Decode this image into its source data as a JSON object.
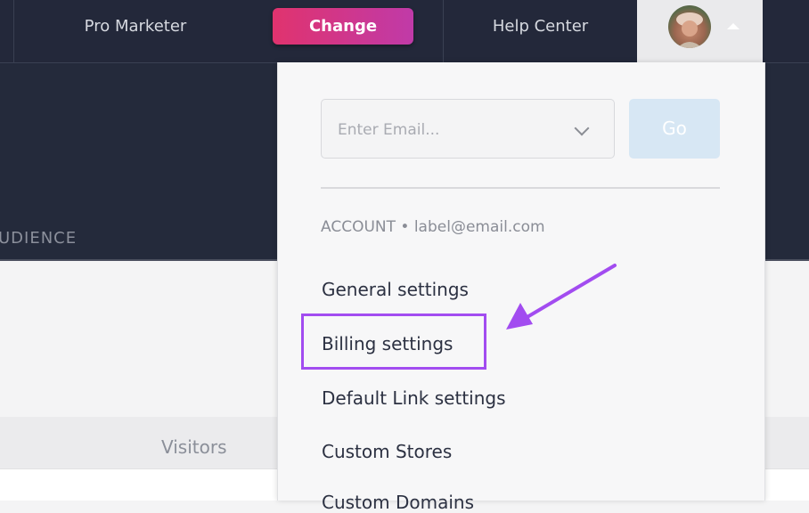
{
  "topbar": {
    "plan_label": "Pro Marketer",
    "change_label": "Change",
    "help_label": "Help Center"
  },
  "background": {
    "section_title_partial": "UDIENCE",
    "table_header_visitors": "Visitors"
  },
  "dropdown": {
    "email_placeholder": "Enter Email...",
    "go_label": "Go",
    "account_label": "ACCOUNT • label@email.com",
    "items": [
      {
        "label": "General settings"
      },
      {
        "label": "Billing settings"
      },
      {
        "label": "Default Link settings"
      },
      {
        "label": "Custom Stores"
      },
      {
        "label": "Custom Domains"
      }
    ]
  },
  "colors": {
    "nav_bg": "#23283a",
    "accent_start": "#e0336e",
    "accent_end": "#c03aa8",
    "annotation": "#a24cf0"
  }
}
